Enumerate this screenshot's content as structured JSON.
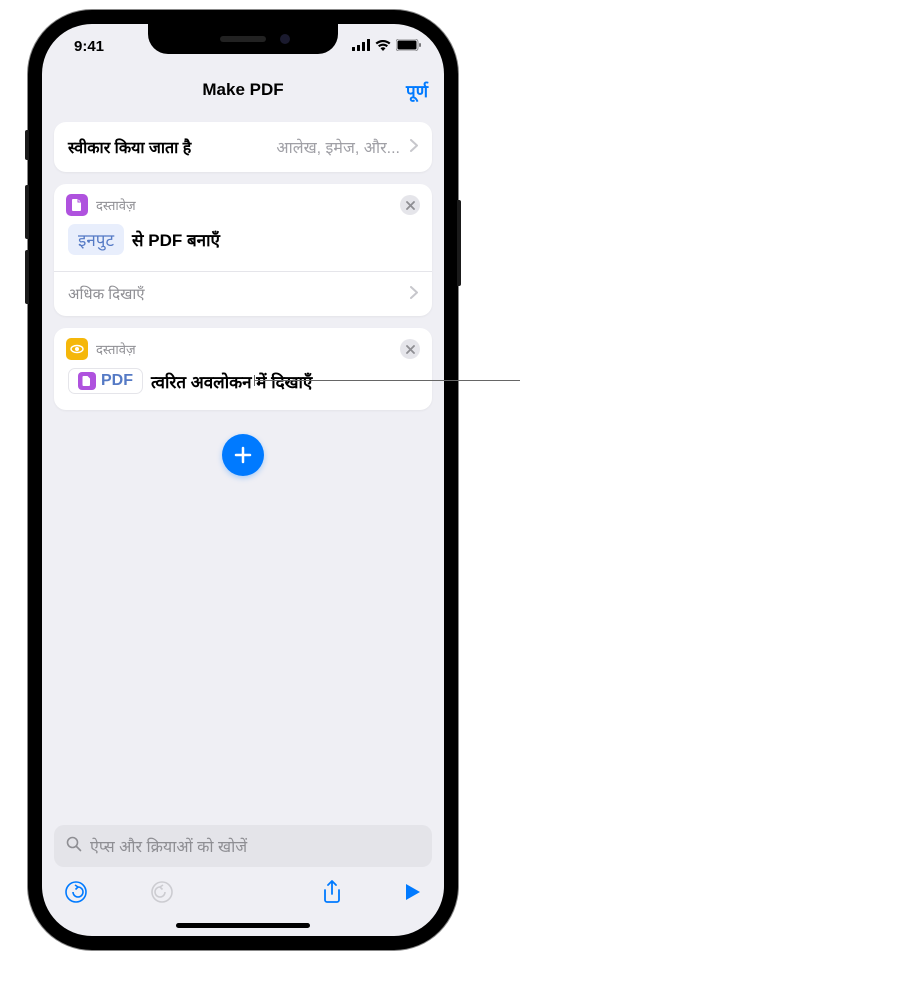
{
  "status": {
    "time": "9:41"
  },
  "nav": {
    "title": "Make PDF",
    "done": "पूर्ण"
  },
  "accepts": {
    "label": "स्वीकार किया जाता है",
    "value": "आलेख, इमेज, और..."
  },
  "action1": {
    "source": "दस्तावेज़",
    "input_token": "इनपुट",
    "text": "से PDF बनाएँ",
    "show_more": "अधिक दिखाएँ"
  },
  "action2": {
    "source": "दस्तावेज़",
    "pdf_token": "PDF",
    "text": "त्वरित अवलोकन में दिखाएँ"
  },
  "search": {
    "placeholder": "ऐप्स और क्रियाओं को खोजें"
  },
  "colors": {
    "accent": "#007aff",
    "doc_purple": "#af52de",
    "preview_yellow": "#f5b70a"
  }
}
